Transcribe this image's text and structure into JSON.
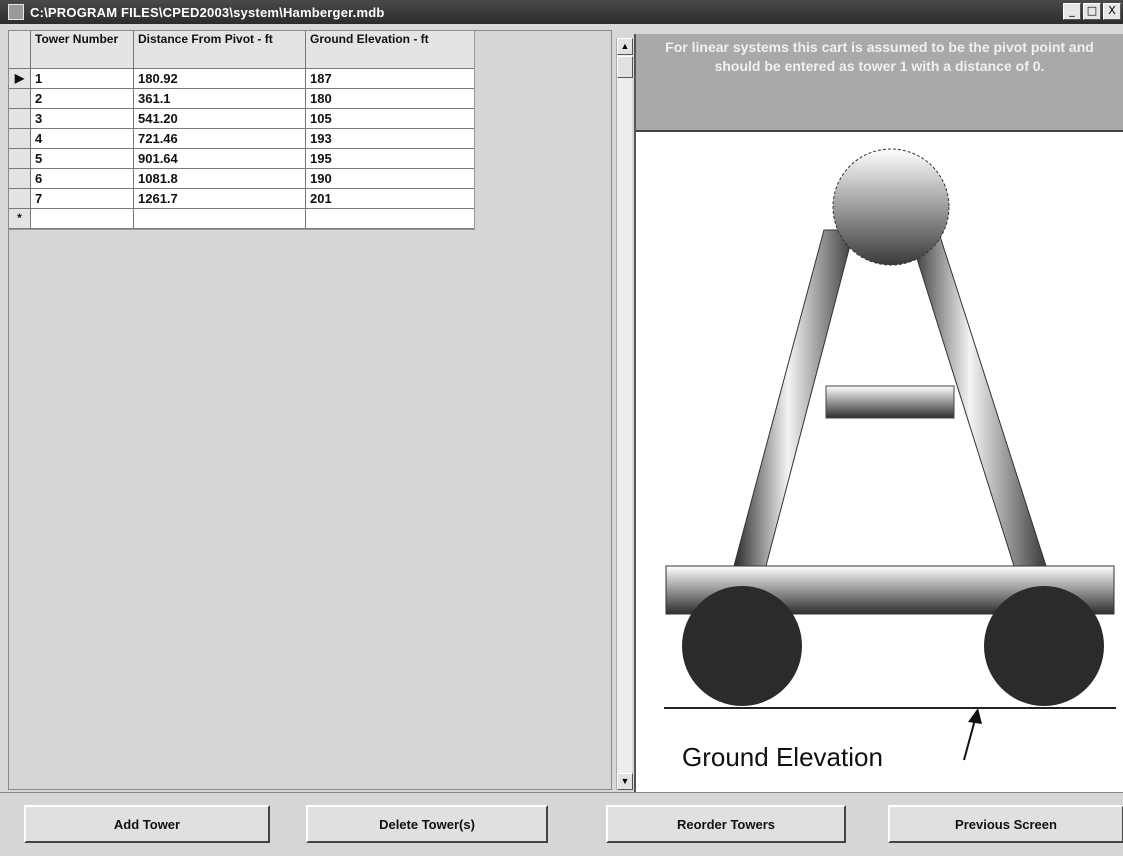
{
  "window": {
    "title": "C:\\PROGRAM FILES\\CPED2003\\system\\Hamberger.mdb",
    "controls": [
      "_",
      "□",
      "X"
    ]
  },
  "grid": {
    "headers": [
      "Tower Number",
      "Distance From Pivot - ft",
      "Ground Elevation - ft"
    ],
    "rows": [
      {
        "indicator": "▶",
        "tower": "1",
        "distance": "180.92",
        "elevation": "187"
      },
      {
        "indicator": "",
        "tower": "2",
        "distance": "361.1",
        "elevation": "180"
      },
      {
        "indicator": "",
        "tower": "3",
        "distance": "541.20",
        "elevation": "105"
      },
      {
        "indicator": "",
        "tower": "4",
        "distance": "721.46",
        "elevation": "193"
      },
      {
        "indicator": "",
        "tower": "5",
        "distance": "901.64",
        "elevation": "195"
      },
      {
        "indicator": "",
        "tower": "6",
        "distance": "1081.8",
        "elevation": "190"
      },
      {
        "indicator": "",
        "tower": "7",
        "distance": "1261.7",
        "elevation": "201"
      }
    ],
    "new_row_indicator": "*"
  },
  "scrollbar": {
    "up": "▲",
    "down": "▼"
  },
  "note": "For linear systems this cart is assumed to be the pivot point and should be entered as tower 1 with a distance of 0.",
  "diagram": {
    "label": "Ground Elevation"
  },
  "buttons": {
    "add": "Add Tower",
    "delete": "Delete Tower(s)",
    "reorder": "Reorder Towers",
    "previous": "Previous Screen"
  }
}
